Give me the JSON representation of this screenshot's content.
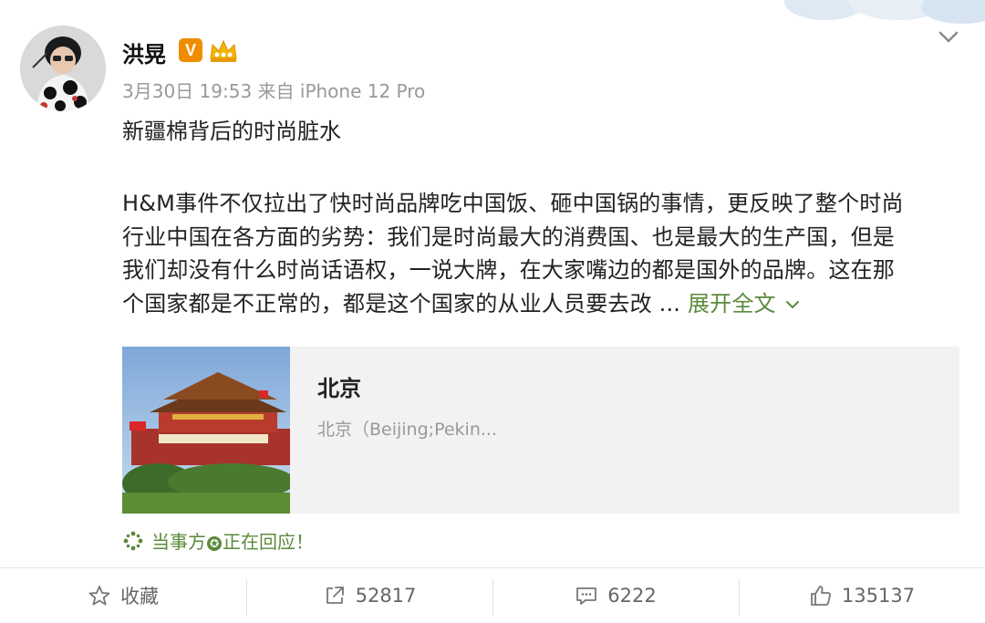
{
  "post": {
    "author": "洪晃",
    "verified_badge": "V",
    "meta": "3月30日 19:53 来自 iPhone 12 Pro",
    "title": "新疆棉背后的时尚脏水",
    "body_lines": [
      "H&M事件不仅拉出了快时尚品牌吃中国饭、砸中国锅的事情，更反映了整个时尚",
      "行业中国在各方面的劣势：我们是时尚最大的消费国、也是最大的生产国，但是",
      "我们却没有什么时尚话语权，一说大牌，在大家嘴边的都是国外的品牌。这在那",
      "个国家都是不正常的，都是这个国家的从业人员要去改 ... "
    ],
    "expand_label": "展开全文",
    "card": {
      "title": "北京",
      "subtitle": "北京（Beijing;Pekin..."
    },
    "respond": {
      "before": "当事方",
      "after": "正在回应！"
    }
  },
  "actions": {
    "favorite_label": "收藏",
    "repost_count": "52817",
    "comment_count": "6222",
    "like_count": "135137"
  },
  "icons": {
    "chevron": "chevron-down-icon",
    "favorite": "star-icon",
    "repost": "share-icon",
    "comment": "comment-icon",
    "like": "thumbs-up-icon"
  },
  "colors": {
    "accent_green": "#5b8a3a",
    "badge_orange": "#f08c00",
    "meta_gray": "#999999",
    "card_bg": "#f2f2f2"
  }
}
